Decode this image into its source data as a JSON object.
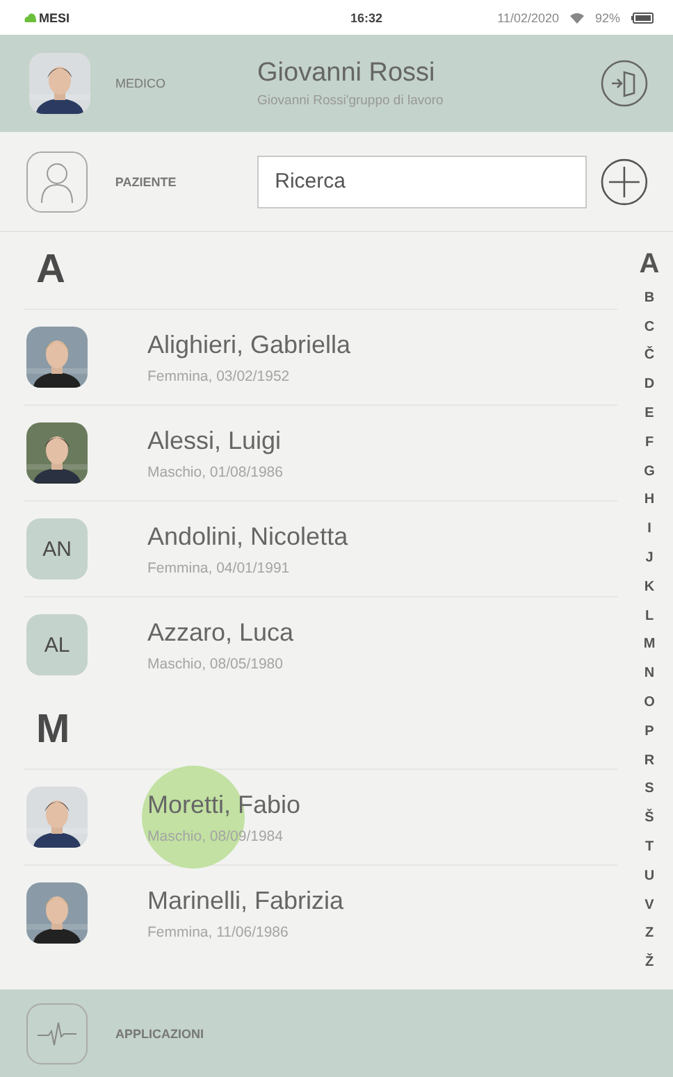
{
  "status_bar": {
    "brand": "MESI",
    "time": "16:32",
    "date": "11/02/2020",
    "battery": "92%"
  },
  "header": {
    "role": "MEDICO",
    "name": "Giovanni Rossi",
    "subtitle": "Giovanni Rossi'gruppo di lavoro"
  },
  "patient_bar": {
    "label": "PAZIENTE",
    "search": {
      "placeholder": "Ricerca"
    }
  },
  "sections": [
    {
      "letter": "A",
      "patients": [
        {
          "name": "Alighieri, Gabriella",
          "details": "Femmina, 03/02/1952",
          "touched": false
        },
        {
          "name": "Alessi, Luigi",
          "details": "Maschio, 01/08/1986",
          "touched": false
        },
        {
          "name": "Andolini, Nicoletta",
          "details": "Femmina, 04/01/1991",
          "avatar": {
            "kind": "initials",
            "text": "AN"
          },
          "touched": false
        },
        {
          "name": "Azzaro, Luca",
          "details": "Maschio, 08/05/1980",
          "avatar": {
            "kind": "initials",
            "text": "AL"
          },
          "touched": false
        }
      ]
    },
    {
      "letter": "M",
      "patients": [
        {
          "name": "Moretti, Fabio",
          "details": "Maschio, 08/09/1984",
          "touched": true
        },
        {
          "name": "Marinelli, Fabrizia",
          "details": "Femmina, 11/06/1986",
          "touched": false
        }
      ]
    }
  ],
  "index": [
    {
      "letter": "A",
      "selected": true
    },
    {
      "letter": "B",
      "selected": false
    },
    {
      "letter": "C",
      "selected": false
    },
    {
      "letter": "Č",
      "selected": false
    },
    {
      "letter": "D",
      "selected": false
    },
    {
      "letter": "E",
      "selected": false
    },
    {
      "letter": "F",
      "selected": false
    },
    {
      "letter": "G",
      "selected": false
    },
    {
      "letter": "H",
      "selected": false
    },
    {
      "letter": "I",
      "selected": false
    },
    {
      "letter": "J",
      "selected": false
    },
    {
      "letter": "K",
      "selected": false
    },
    {
      "letter": "L",
      "selected": false
    },
    {
      "letter": "M",
      "selected": false
    },
    {
      "letter": "N",
      "selected": false
    },
    {
      "letter": "O",
      "selected": false
    },
    {
      "letter": "P",
      "selected": false
    },
    {
      "letter": "R",
      "selected": false
    },
    {
      "letter": "S",
      "selected": false
    },
    {
      "letter": "Š",
      "selected": false
    },
    {
      "letter": "T",
      "selected": false
    },
    {
      "letter": "U",
      "selected": false
    },
    {
      "letter": "V",
      "selected": false
    },
    {
      "letter": "Z",
      "selected": false
    },
    {
      "letter": "Ž",
      "selected": false
    }
  ],
  "footer": {
    "label": "APPLICAZIONI"
  }
}
